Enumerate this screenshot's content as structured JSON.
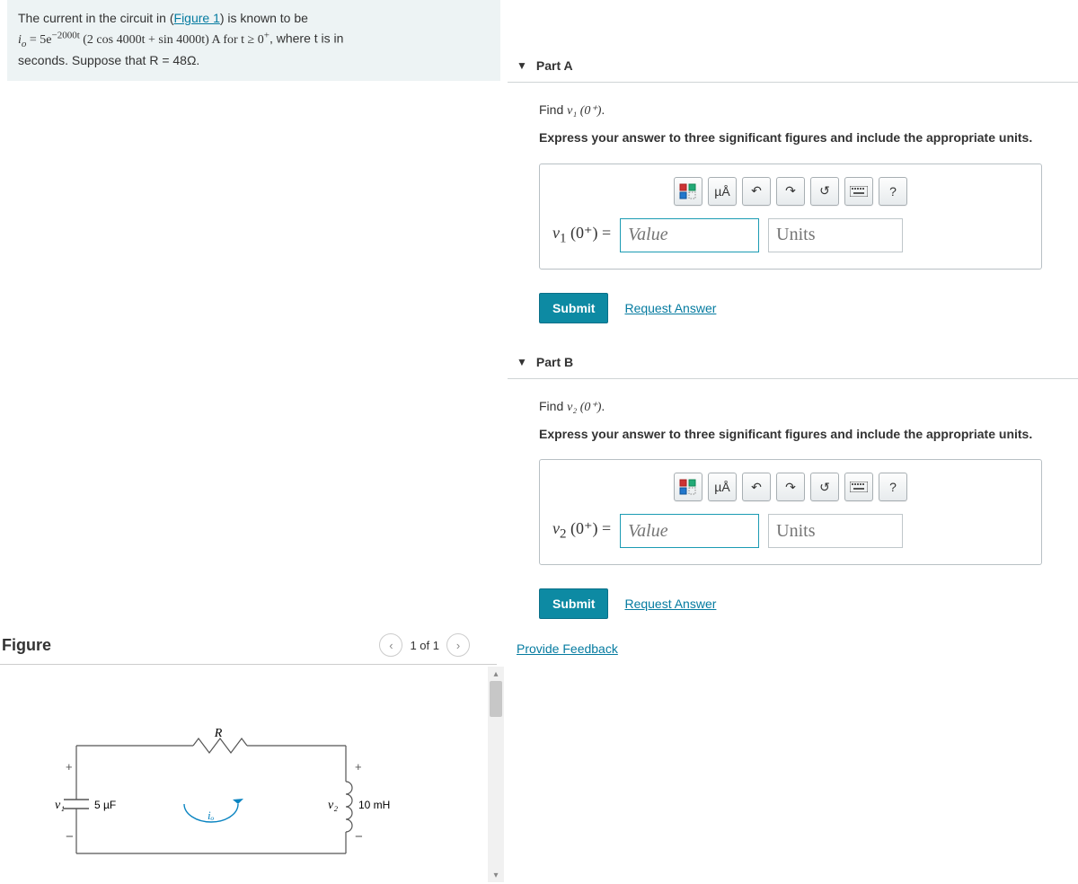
{
  "problem": {
    "line1_pre": "The current in the circuit in (",
    "figure_link": "Figure 1",
    "line1_post": ") is known to be",
    "eq_lhs": "i",
    "eq_sub": "o",
    "eq_mid": " = 5e",
    "eq_exp": "−2000t",
    "eq_trig": " (2 cos 4000t + sin 4000t) A for t ≥ 0",
    "eq_sup2": "+",
    "line2_post": ", where t is in",
    "line3": "seconds. Suppose that R = 48Ω."
  },
  "figure": {
    "title": "Figure",
    "counter": "1 of 1",
    "labels": {
      "R": "R",
      "v1": "v₁",
      "cap": "5 µF",
      "io": "iₒ",
      "v2": "v₂",
      "ind": "10 mH"
    }
  },
  "partA": {
    "title": "Part A",
    "find_pre": "Find ",
    "find_var": "v₁ (0⁺)",
    "find_post": ".",
    "instruction": "Express your answer to three significant figures and include the appropriate units.",
    "label_pre": "v",
    "label_sub": "1",
    "label_arg": " (0⁺) = ",
    "value_ph": "Value",
    "units_ph": "Units",
    "submit": "Submit",
    "request": "Request Answer"
  },
  "partB": {
    "title": "Part B",
    "find_pre": "Find ",
    "find_var": "v₂ (0⁺)",
    "find_post": ".",
    "instruction": "Express your answer to three significant figures and include the appropriate units.",
    "label_pre": "v",
    "label_sub": "2",
    "label_arg": " (0⁺) = ",
    "value_ph": "Value",
    "units_ph": "Units",
    "submit": "Submit",
    "request": "Request Answer"
  },
  "feedback": "Provide Feedback",
  "toolbar": {
    "units_mu": "µÅ",
    "help": "?"
  }
}
